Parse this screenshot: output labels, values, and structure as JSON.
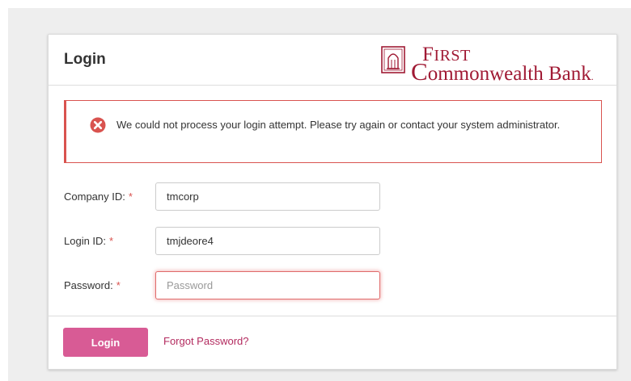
{
  "header": {
    "title": "Login",
    "logo": {
      "line1_initial": "F",
      "line1_rest": "IRST",
      "line2_initial": "C",
      "line2_rest": "ommonwealth Bank",
      "line2_dot": ".",
      "color": "#a01a34"
    }
  },
  "alert": {
    "icon": "error-circle-x-icon",
    "message": "We could not process your login attempt. Please try again or contact your system administrator.",
    "color": "#d9534f"
  },
  "form": {
    "company_id": {
      "label": "Company ID:",
      "required_mark": "*",
      "value": "tmcorp",
      "placeholder": ""
    },
    "login_id": {
      "label": "Login ID:",
      "required_mark": "*",
      "value": "tmjdeore4",
      "placeholder": ""
    },
    "password": {
      "label": "Password:",
      "required_mark": "*",
      "value": "",
      "placeholder": "Password"
    }
  },
  "footer": {
    "login_label": "Login",
    "forgot_label": "Forgot Password?",
    "button_color": "#d85b95"
  }
}
